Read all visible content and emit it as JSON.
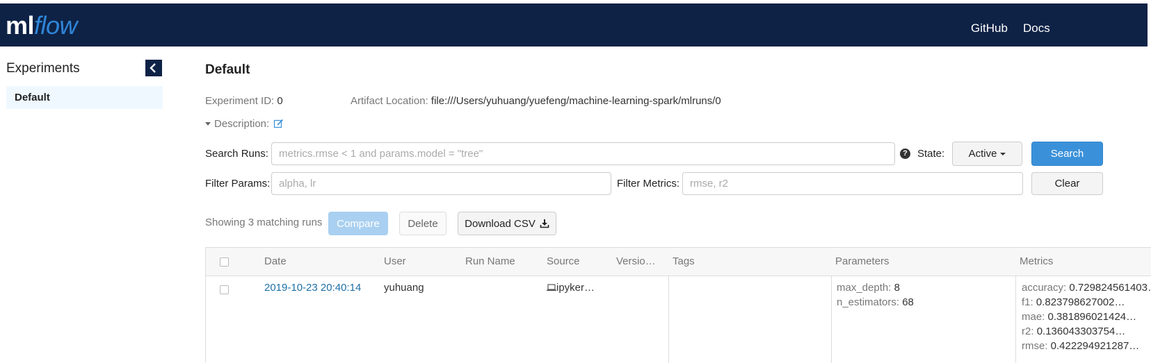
{
  "header": {
    "logo_ml": "ml",
    "logo_flow": "flow",
    "nav": [
      "GitHub",
      "Docs"
    ],
    "background": "#0e2246"
  },
  "sidebar": {
    "title": "Experiments",
    "items": [
      {
        "label": "Default",
        "selected": true
      }
    ]
  },
  "experiment": {
    "title": "Default",
    "id_label": "Experiment ID:",
    "id_value": "0",
    "artifact_label": "Artifact Location:",
    "artifact_value": "file:///Users/yuhuang/yuefeng/machine-learning-spark/mlruns/0",
    "description_label": "Description:"
  },
  "search": {
    "runs_label": "Search Runs:",
    "runs_placeholder": "metrics.rmse < 1 and params.model = \"tree\"",
    "state_label": "State:",
    "state_value": "Active",
    "search_button": "Search",
    "filter_params_label": "Filter Params:",
    "filter_params_placeholder": "alpha, lr",
    "filter_metrics_label": "Filter Metrics:",
    "filter_metrics_placeholder": "rmse, r2",
    "clear_button": "Clear"
  },
  "toolbar": {
    "showing": "Showing 3 matching runs",
    "compare": "Compare",
    "delete": "Delete",
    "download": "Download CSV"
  },
  "table": {
    "columns": [
      "Date",
      "User",
      "Run Name",
      "Source",
      "Versio…",
      "Tags",
      "Parameters",
      "Metrics"
    ],
    "rows": [
      {
        "date": "2019-10-23 20:40:14",
        "user": "yuhuang",
        "run_name": "",
        "source": "ipyker…",
        "version": "",
        "tags": "",
        "parameters": [
          {
            "key": "max_depth:",
            "value": "8"
          },
          {
            "key": "n_estimators:",
            "value": "68"
          }
        ],
        "metrics": [
          {
            "key": "accuracy:",
            "value": "0.729824561403…"
          },
          {
            "key": "f1:",
            "value": "0.823798627002…"
          },
          {
            "key": "mae:",
            "value": "0.381896021424…"
          },
          {
            "key": "r2:",
            "value": "0.136043303754…"
          },
          {
            "key": "rmse:",
            "value": "0.422294921287…"
          }
        ]
      }
    ]
  },
  "colors": {
    "primary": "#3b91d9",
    "link": "#1c6fa8",
    "selected_bg": "#f0f8ff"
  }
}
